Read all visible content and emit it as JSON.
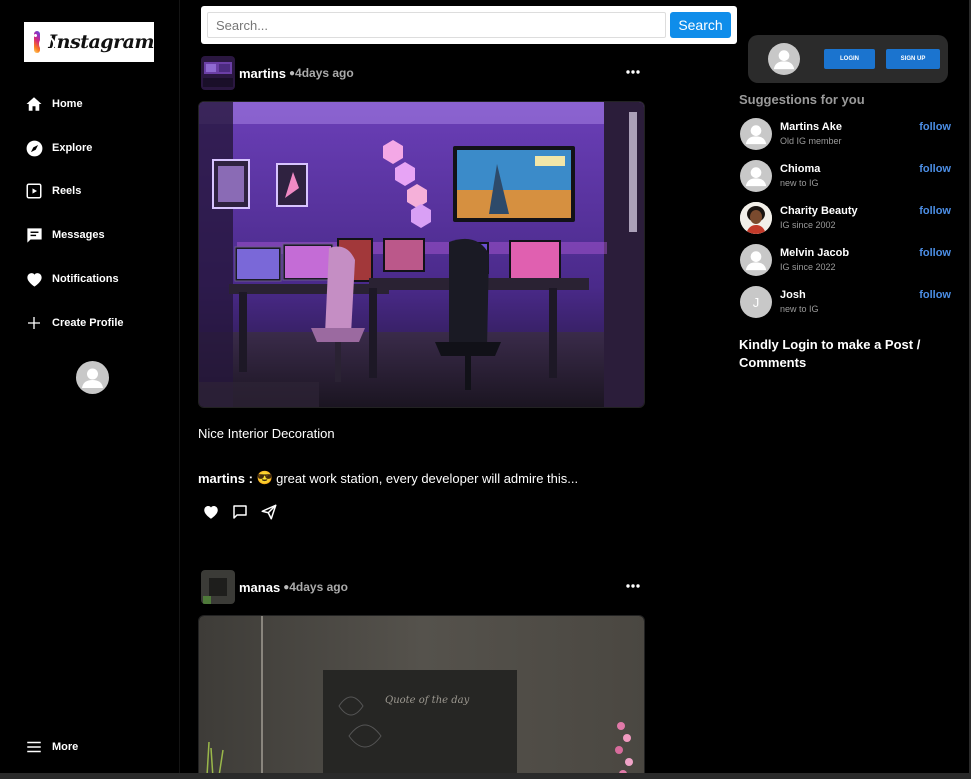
{
  "app": {
    "logo_text": "Instagram"
  },
  "sidebar": {
    "items": [
      {
        "label": "Home",
        "icon": "home-icon"
      },
      {
        "label": "Explore",
        "icon": "compass-icon"
      },
      {
        "label": "Reels",
        "icon": "reels-icon"
      },
      {
        "label": "Messages",
        "icon": "message-icon"
      },
      {
        "label": "Notifications",
        "icon": "heart-icon"
      },
      {
        "label": "Create Profile",
        "icon": "plus-icon"
      }
    ],
    "more_label": "More"
  },
  "search": {
    "placeholder": "Search...",
    "button_label": "Search"
  },
  "auth": {
    "login_label": "LOGIN",
    "signup_label": "SIGN UP"
  },
  "feed": {
    "posts": [
      {
        "username": "martins",
        "time": "4days ago",
        "caption": "Nice Interior Decoration",
        "comment_user": "martins :",
        "comment_emoji": "😎",
        "comment_text": "great work station, every developer will admire this..."
      },
      {
        "username": "manas",
        "time": "4days ago",
        "image_text": "Quote of the day"
      }
    ]
  },
  "suggestions": {
    "title": "Suggestions for you",
    "follow_label": "follow",
    "items": [
      {
        "name": "Martins Ake",
        "sub": "Old IG member"
      },
      {
        "name": "Chioma",
        "sub": "new to IG"
      },
      {
        "name": "Charity Beauty",
        "sub": "IG since 2002"
      },
      {
        "name": "Melvin Jacob",
        "sub": "IG since 2022"
      },
      {
        "name": "Josh",
        "sub": "new to IG",
        "initial": "J"
      }
    ],
    "login_note": "Kindly Login to make a Post / Comments"
  },
  "colors": {
    "background": "#000000",
    "accent": "#0f8dea",
    "follow": "#4c8ee5",
    "auth_button": "#1b74cf"
  }
}
